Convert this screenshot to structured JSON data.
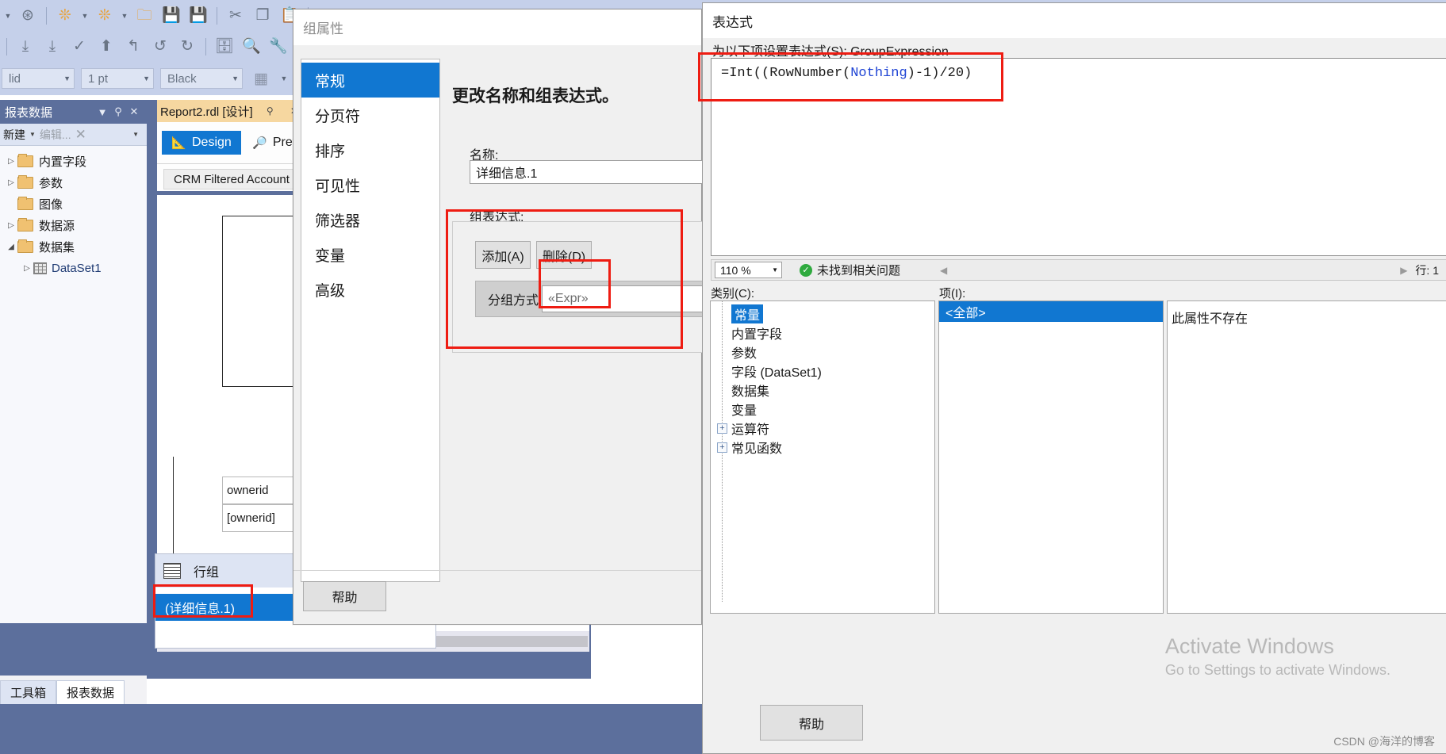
{
  "toolbar": {
    "row1_icons": [
      "dropdown-caret",
      "navigate-forward",
      "new-report",
      "new-item",
      "open-folder",
      "save",
      "save-all",
      "cut",
      "copy",
      "paste"
    ],
    "row2_icons": [
      "step-into",
      "step-over",
      "check",
      "upload",
      "undo",
      "history",
      "redo",
      "database",
      "preview",
      "wrench"
    ],
    "format": {
      "line_style": "lid",
      "line_width": "1 pt",
      "line_color": "Black",
      "border_label": "border-grid"
    }
  },
  "left_panel": {
    "title": "报表数据",
    "toolbar": {
      "new": "新建",
      "edit": "编辑...",
      "delete": "delete-icon"
    },
    "tree": [
      {
        "label": "内置字段",
        "expandable": true,
        "indent": 0
      },
      {
        "label": "参数",
        "expandable": true,
        "indent": 0
      },
      {
        "label": "图像",
        "expandable": false,
        "indent": 0
      },
      {
        "label": "数据源",
        "expandable": true,
        "indent": 0
      },
      {
        "label": "数据集",
        "expandable": true,
        "expanded": true,
        "indent": 0
      },
      {
        "label": "DataSet1",
        "expandable": true,
        "indent": 1,
        "kind": "dataset"
      }
    ]
  },
  "designer": {
    "doc_tab": "Report2.rdl [设计]",
    "tabs": [
      {
        "label": "Design",
        "icon": "ruler-icon",
        "active": true
      },
      {
        "label": "Preview",
        "icon": "preview-icon",
        "active": false
      }
    ],
    "dataset_label": "CRM Filtered Account",
    "cells": {
      "header_expr": "[ownerid",
      "footer_header": "ownerid",
      "footer_expr": "[ownerid]"
    },
    "row_group": {
      "title": "行组",
      "selected_item": "(详细信息.1)"
    }
  },
  "bottom_tabs": [
    {
      "label": "工具箱",
      "active": false
    },
    {
      "label": "报表数据",
      "active": true
    }
  ],
  "group_dialog": {
    "title": "组属性",
    "nav": [
      {
        "label": "常规",
        "active": true
      },
      {
        "label": "分页符",
        "active": false
      },
      {
        "label": "排序",
        "active": false
      },
      {
        "label": "可见性",
        "active": false
      },
      {
        "label": "筛选器",
        "active": false
      },
      {
        "label": "变量",
        "active": false
      },
      {
        "label": "高级",
        "active": false
      }
    ],
    "heading": "更改名称和组表达式。",
    "name_label": "名称:",
    "name_value": "详细信息.1",
    "group_expr_label": "组表达式:",
    "add_button": "添加(A)",
    "delete_button": "删除(D)",
    "group_by_label": "分组方式:",
    "expr_cell_value": "«Expr»",
    "help_button": "帮助"
  },
  "expression_dialog": {
    "title": "表达式",
    "subtitle": "为以下项设置表达式(S): GroupExpression",
    "expression": "=Int((RowNumber(Nothing)-1)/20)",
    "expression_tokens": [
      {
        "t": "=Int((RowNumber(",
        "c": "plain"
      },
      {
        "t": "Nothing",
        "c": "blue"
      },
      {
        "t": ")-1)/20)",
        "c": "plain"
      }
    ],
    "status": {
      "zoom": "110 %",
      "message": "未找到相关问题",
      "line": "行: 1"
    },
    "category_label": "类别(C):",
    "categories": [
      {
        "label": "常量",
        "selected": true,
        "expandable": false
      },
      {
        "label": "内置字段",
        "selected": false,
        "expandable": false
      },
      {
        "label": "参数",
        "selected": false,
        "expandable": false
      },
      {
        "label": "字段 (DataSet1)",
        "selected": false,
        "expandable": false,
        "blue_part": "(DataSet1)"
      },
      {
        "label": "数据集",
        "selected": false,
        "expandable": false
      },
      {
        "label": "变量",
        "selected": false,
        "expandable": false
      },
      {
        "label": "运算符",
        "selected": false,
        "expandable": true
      },
      {
        "label": "常见函数",
        "selected": false,
        "expandable": true
      }
    ],
    "items_label": "项(I):",
    "items": [
      {
        "label": "<全部>",
        "selected": true
      }
    ],
    "description": "此属性不存在",
    "help_button": "帮助"
  },
  "watermark": {
    "line1": "Activate Windows",
    "line2": "Go to Settings to activate Windows.",
    "credit": "CSDN @海洋的博客"
  },
  "colors": {
    "accent_blue": "#1177d1",
    "highlight_red": "#ee1c12",
    "shell_blue": "#c5d0ea",
    "panel_navy": "#5c6f9c",
    "tab_gold": "#f6d7a0"
  }
}
